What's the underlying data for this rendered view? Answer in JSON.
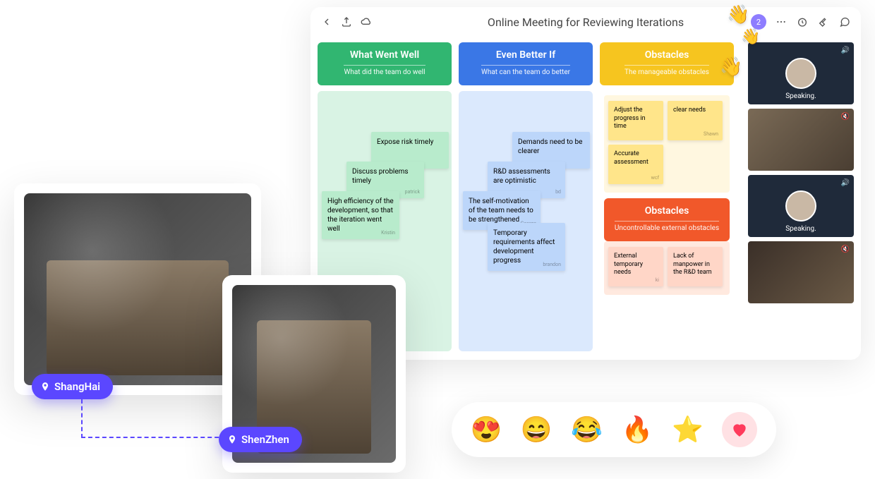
{
  "board": {
    "title": "Online Meeting for Reviewing Iterations",
    "avatar_initial": "2",
    "columns": [
      {
        "title": "What Went Well",
        "subtitle": "What did the team do well",
        "notes": [
          {
            "text": "Expose risk timely",
            "author": ""
          },
          {
            "text": "Discuss problems timely",
            "author": "patrick"
          },
          {
            "text": "High efficiency of the development, so that the iteration went well",
            "author": "Kristin"
          }
        ]
      },
      {
        "title": "Even Better If",
        "subtitle": "What can the team do better",
        "notes": [
          {
            "text": "Demands need to be clearer",
            "author": ""
          },
          {
            "text": "R&D assessments are optimistic",
            "author": "bd"
          },
          {
            "text": "The self-motivation of the team needs to be strengthened",
            "author": "George"
          },
          {
            "text": "Temporary requirements affect development progress",
            "author": "brandon"
          }
        ]
      },
      {
        "title_a": "Obstacles",
        "subtitle_a": "The manageable obstacles",
        "yellow_notes": [
          {
            "text": "Adjust the progress in time",
            "author": ""
          },
          {
            "text": "clear needs",
            "author": "Shawn"
          },
          {
            "text": "Accurate assessment",
            "author": "wcf"
          }
        ],
        "title_b": "Obstacles",
        "subtitle_b": "Uncontrollable external obstacles",
        "pink_notes": [
          {
            "text": "External temporary needs",
            "author": "ki"
          },
          {
            "text": "Lack of manpower in the R&D team",
            "author": ""
          }
        ]
      }
    ],
    "video_tiles": [
      {
        "label": "Speaking.",
        "type": "avatar"
      },
      {
        "label": "",
        "type": "group"
      },
      {
        "label": "Speaking.",
        "type": "avatar"
      },
      {
        "label": "",
        "type": "group"
      }
    ]
  },
  "locations": {
    "a": "ShangHai",
    "b": "ShenZhen"
  },
  "emojis": [
    "😍",
    "😄",
    "😂",
    "🔥",
    "⭐"
  ]
}
